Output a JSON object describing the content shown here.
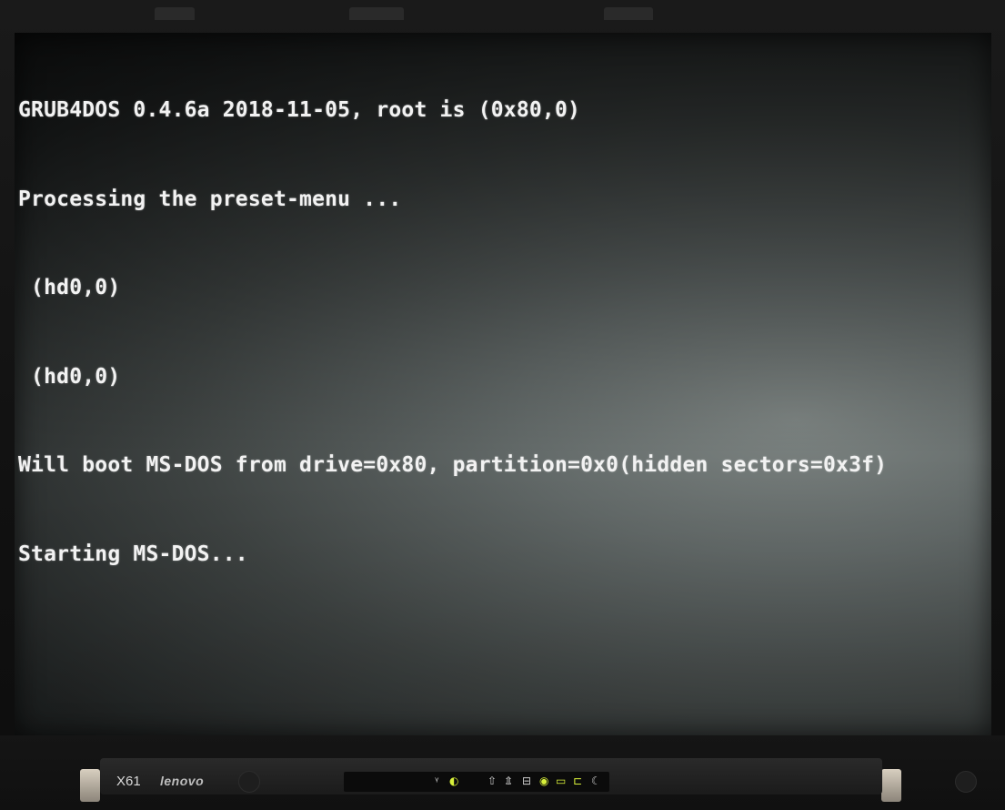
{
  "console": {
    "lines": [
      "GRUB4DOS 0.4.6a 2018-11-05, root is (0x80,0)",
      "Processing the preset-menu ...",
      " (hd0,0)",
      " (hd0,0)",
      "Will boot MS-DOS from drive=0x80, partition=0x0(hidden sectors=0x3f)",
      "Starting MS-DOS..."
    ],
    "text_color": "#f2f2f2"
  },
  "bezel": {
    "model_label": "X61",
    "brand_logo": "lenovo",
    "led_indicator_color": "#d8f03a",
    "indicators": [
      {
        "icon": "wireless-icon",
        "glyph": "ᵞ"
      },
      {
        "icon": "wireless-on-icon",
        "glyph": "◐",
        "on": true
      },
      {
        "icon": "caps-lock-icon",
        "glyph": "⇧"
      },
      {
        "icon": "num-lock-icon",
        "glyph": "⇭"
      },
      {
        "icon": "disk-activity-icon",
        "glyph": "⊟"
      },
      {
        "icon": "power-icon",
        "glyph": "◉",
        "on": true
      },
      {
        "icon": "battery-icon",
        "glyph": "▭",
        "on": true
      },
      {
        "icon": "ac-power-icon",
        "glyph": "⊏",
        "on": true
      },
      {
        "icon": "sleep-moon-icon",
        "glyph": "☾"
      }
    ]
  }
}
